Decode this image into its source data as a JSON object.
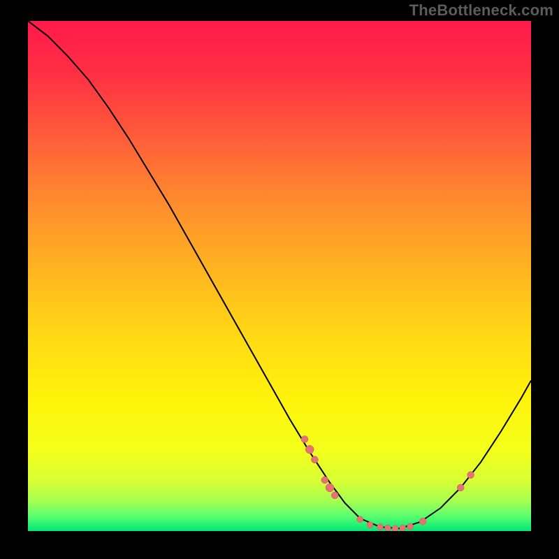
{
  "watermark": "TheBottleneck.com",
  "colors": {
    "curve": "#000000",
    "marker_fill": "#e57373",
    "marker_stroke": "#c85a5a",
    "gradient_stops": [
      {
        "offset": 0.0,
        "color": "#ff1a4b"
      },
      {
        "offset": 0.1,
        "color": "#ff2e44"
      },
      {
        "offset": 0.22,
        "color": "#ff5a3a"
      },
      {
        "offset": 0.35,
        "color": "#ff8a2e"
      },
      {
        "offset": 0.5,
        "color": "#ffb81f"
      },
      {
        "offset": 0.62,
        "color": "#ffd914"
      },
      {
        "offset": 0.74,
        "color": "#fff30a"
      },
      {
        "offset": 0.84,
        "color": "#f4ff1a"
      },
      {
        "offset": 0.9,
        "color": "#d9ff33"
      },
      {
        "offset": 0.94,
        "color": "#a8ff4f"
      },
      {
        "offset": 0.97,
        "color": "#5cff6e"
      },
      {
        "offset": 1.0,
        "color": "#00e878"
      }
    ]
  },
  "chart_data": {
    "type": "line",
    "title": "",
    "xlabel": "",
    "ylabel": "",
    "xlim": [
      0,
      100
    ],
    "ylim": [
      0,
      100
    ],
    "series": [
      {
        "name": "curve",
        "x": [
          0,
          4,
          8,
          12,
          16,
          20,
          24,
          28,
          32,
          36,
          40,
          44,
          48,
          52,
          56,
          60,
          63,
          66,
          70,
          74,
          78,
          82,
          86,
          90,
          94,
          98,
          100
        ],
        "y": [
          100,
          97,
          93,
          88.5,
          83,
          77,
          70.5,
          64,
          57,
          50,
          43,
          36,
          29,
          22,
          15.5,
          9.5,
          5.5,
          2.5,
          0.8,
          0.5,
          1.8,
          4.5,
          8.5,
          13.5,
          19.5,
          26,
          29.5
        ]
      }
    ],
    "markers": [
      {
        "x": 55,
        "y": 18,
        "r": 5
      },
      {
        "x": 56,
        "y": 16,
        "r": 6
      },
      {
        "x": 57,
        "y": 14,
        "r": 5
      },
      {
        "x": 59,
        "y": 10,
        "r": 5
      },
      {
        "x": 60,
        "y": 8.5,
        "r": 6
      },
      {
        "x": 61,
        "y": 7,
        "r": 5
      },
      {
        "x": 66,
        "y": 2.3,
        "r": 4.5
      },
      {
        "x": 68,
        "y": 1.2,
        "r": 4.5
      },
      {
        "x": 70,
        "y": 0.8,
        "r": 4.5
      },
      {
        "x": 71.5,
        "y": 0.6,
        "r": 4.5
      },
      {
        "x": 73,
        "y": 0.5,
        "r": 4.5
      },
      {
        "x": 74.5,
        "y": 0.6,
        "r": 4.5
      },
      {
        "x": 76,
        "y": 0.9,
        "r": 4.5
      },
      {
        "x": 78.5,
        "y": 1.9,
        "r": 5
      },
      {
        "x": 86,
        "y": 8.5,
        "r": 5
      },
      {
        "x": 88,
        "y": 11,
        "r": 5
      }
    ]
  }
}
